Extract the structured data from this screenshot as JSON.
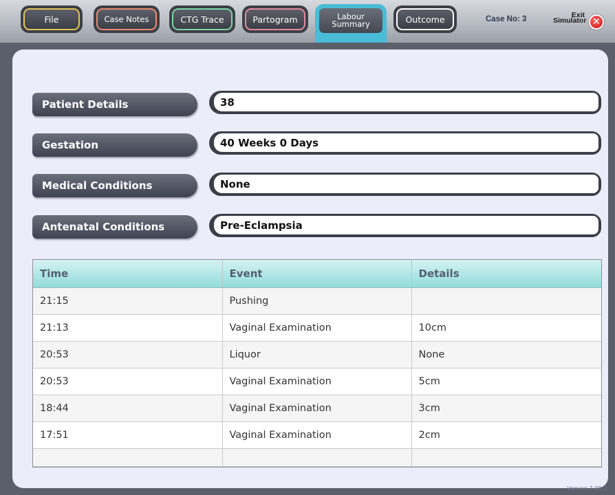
{
  "tabs": [
    {
      "label": "File",
      "color": "#e1c55c"
    },
    {
      "label": "Case Notes",
      "color": "#ea8c70"
    },
    {
      "label": "CTG Trace",
      "color": "#7fd6a5"
    },
    {
      "label": "Partogram",
      "color": "#e58aa0"
    },
    {
      "label": "Labour Summary",
      "color": "#49bcd8",
      "active": true
    },
    {
      "label": "Outcome",
      "color": "#ffffff"
    }
  ],
  "case_no": "Case No: 3",
  "exit_label": "Exit Simulator",
  "fields": [
    {
      "label": "Patient Details",
      "value": "38"
    },
    {
      "label": "Gestation",
      "value": "40 Weeks 0 Days"
    },
    {
      "label": "Medical Conditions",
      "value": "None"
    },
    {
      "label": "Antenatal Conditions",
      "value": "Pre-Eclampsia"
    }
  ],
  "table": {
    "headers": [
      "Time",
      "Event",
      "Details"
    ],
    "rows": [
      [
        "21:15",
        "Pushing",
        ""
      ],
      [
        "21:13",
        "Vaginal Examination",
        "10cm"
      ],
      [
        "20:53",
        "Liquor",
        "None"
      ],
      [
        "20:53",
        "Vaginal Examination",
        "5cm"
      ],
      [
        "18:44",
        "Vaginal Examination",
        "3cm"
      ],
      [
        "17:51",
        "Vaginal Examination",
        "2cm"
      ],
      [
        "",
        "",
        ""
      ]
    ]
  },
  "version": "Version 3.00.3"
}
